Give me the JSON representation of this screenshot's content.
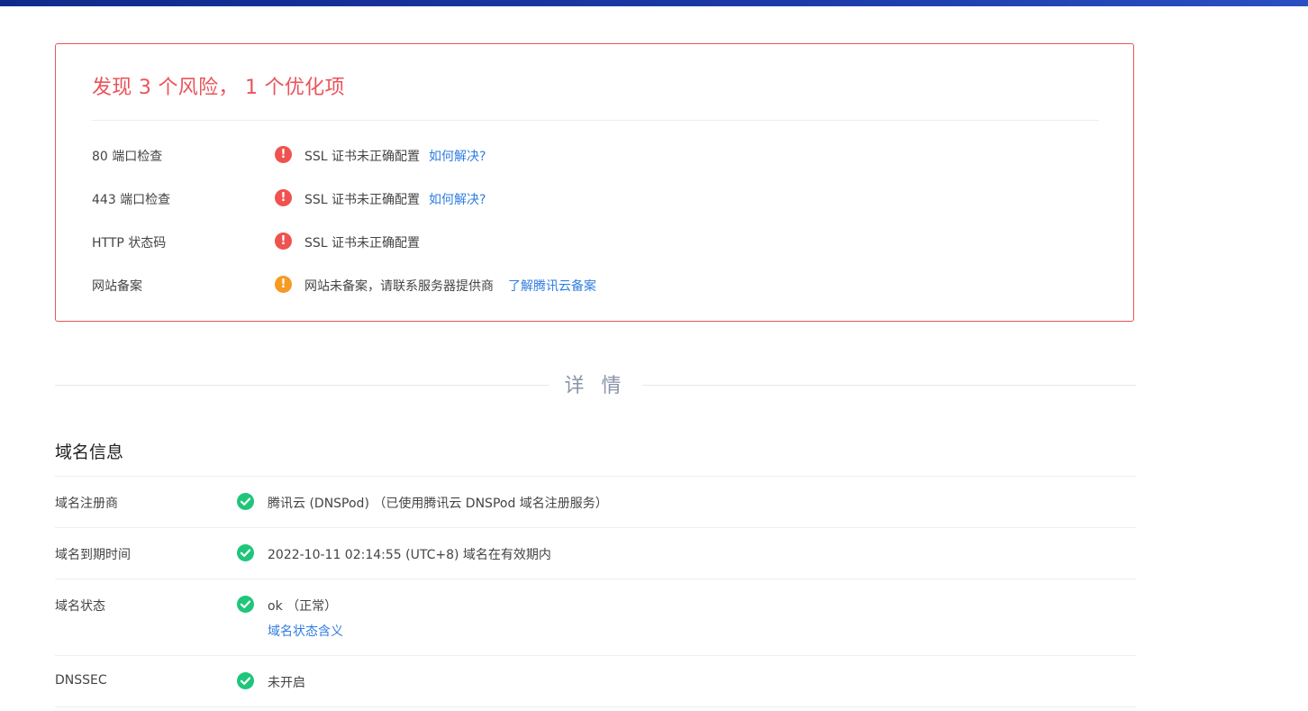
{
  "summary": {
    "title": "发现 3 个风险， 1 个优化项"
  },
  "risks": [
    {
      "label": "80 端口检查",
      "level": "error",
      "message": "SSL 证书未正确配置",
      "link": "如何解决?"
    },
    {
      "label": "443 端口检查",
      "level": "error",
      "message": "SSL 证书未正确配置",
      "link": "如何解决?"
    },
    {
      "label": "HTTP 状态码",
      "level": "error",
      "message": "SSL 证书未正确配置",
      "link": ""
    },
    {
      "label": "网站备案",
      "level": "warning",
      "message": "网站未备案，请联系服务器提供商",
      "link": "了解腾讯云备案"
    }
  ],
  "details": {
    "title": "详 情"
  },
  "domain_info": {
    "title": "域名信息",
    "rows": [
      {
        "label": "域名注册商",
        "value": "腾讯云 (DNSPod) （已使用腾讯云 DNSPod 域名注册服务）",
        "sub_link": ""
      },
      {
        "label": "域名到期时间",
        "value": "2022-10-11 02:14:55 (UTC+8) 域名在有效期内",
        "sub_link": ""
      },
      {
        "label": "域名状态",
        "value": "ok （正常）",
        "sub_link": "域名状态含义"
      },
      {
        "label": "DNSSEC",
        "value": "未开启",
        "sub_link": ""
      }
    ]
  },
  "colors": {
    "risk": "#e9545a",
    "error_icon": "#f0524f",
    "warning_icon": "#f59a23",
    "ok_icon": "#1fc67a",
    "link": "#2f7de1"
  },
  "icons": {
    "error": "exclamation-circle-icon",
    "warning": "warning-circle-icon",
    "ok": "check-circle-icon"
  }
}
